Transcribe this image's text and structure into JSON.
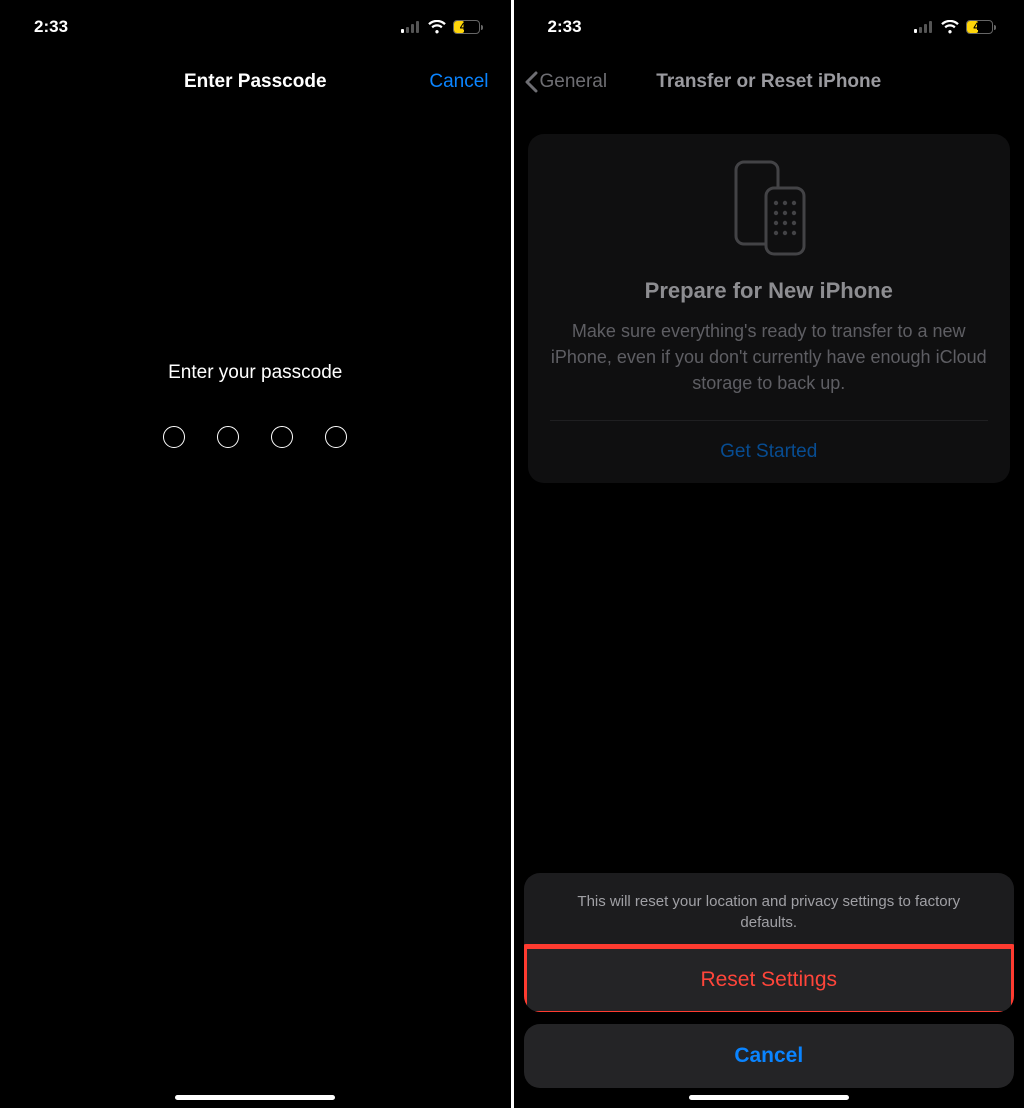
{
  "status": {
    "time": "2:33",
    "battery_level": "43"
  },
  "left": {
    "title": "Enter Passcode",
    "cancel": "Cancel",
    "prompt": "Enter your passcode",
    "digits": 4
  },
  "right": {
    "back_label": "General",
    "title": "Transfer or Reset iPhone",
    "card": {
      "title": "Prepare for New iPhone",
      "body": "Make sure everything's ready to transfer to a new iPhone, even if you don't currently have enough iCloud storage to back up.",
      "cta": "Get Started"
    },
    "sheet": {
      "message": "This will reset your location and privacy settings to factory defaults.",
      "reset": "Reset Settings",
      "cancel": "Cancel"
    }
  }
}
